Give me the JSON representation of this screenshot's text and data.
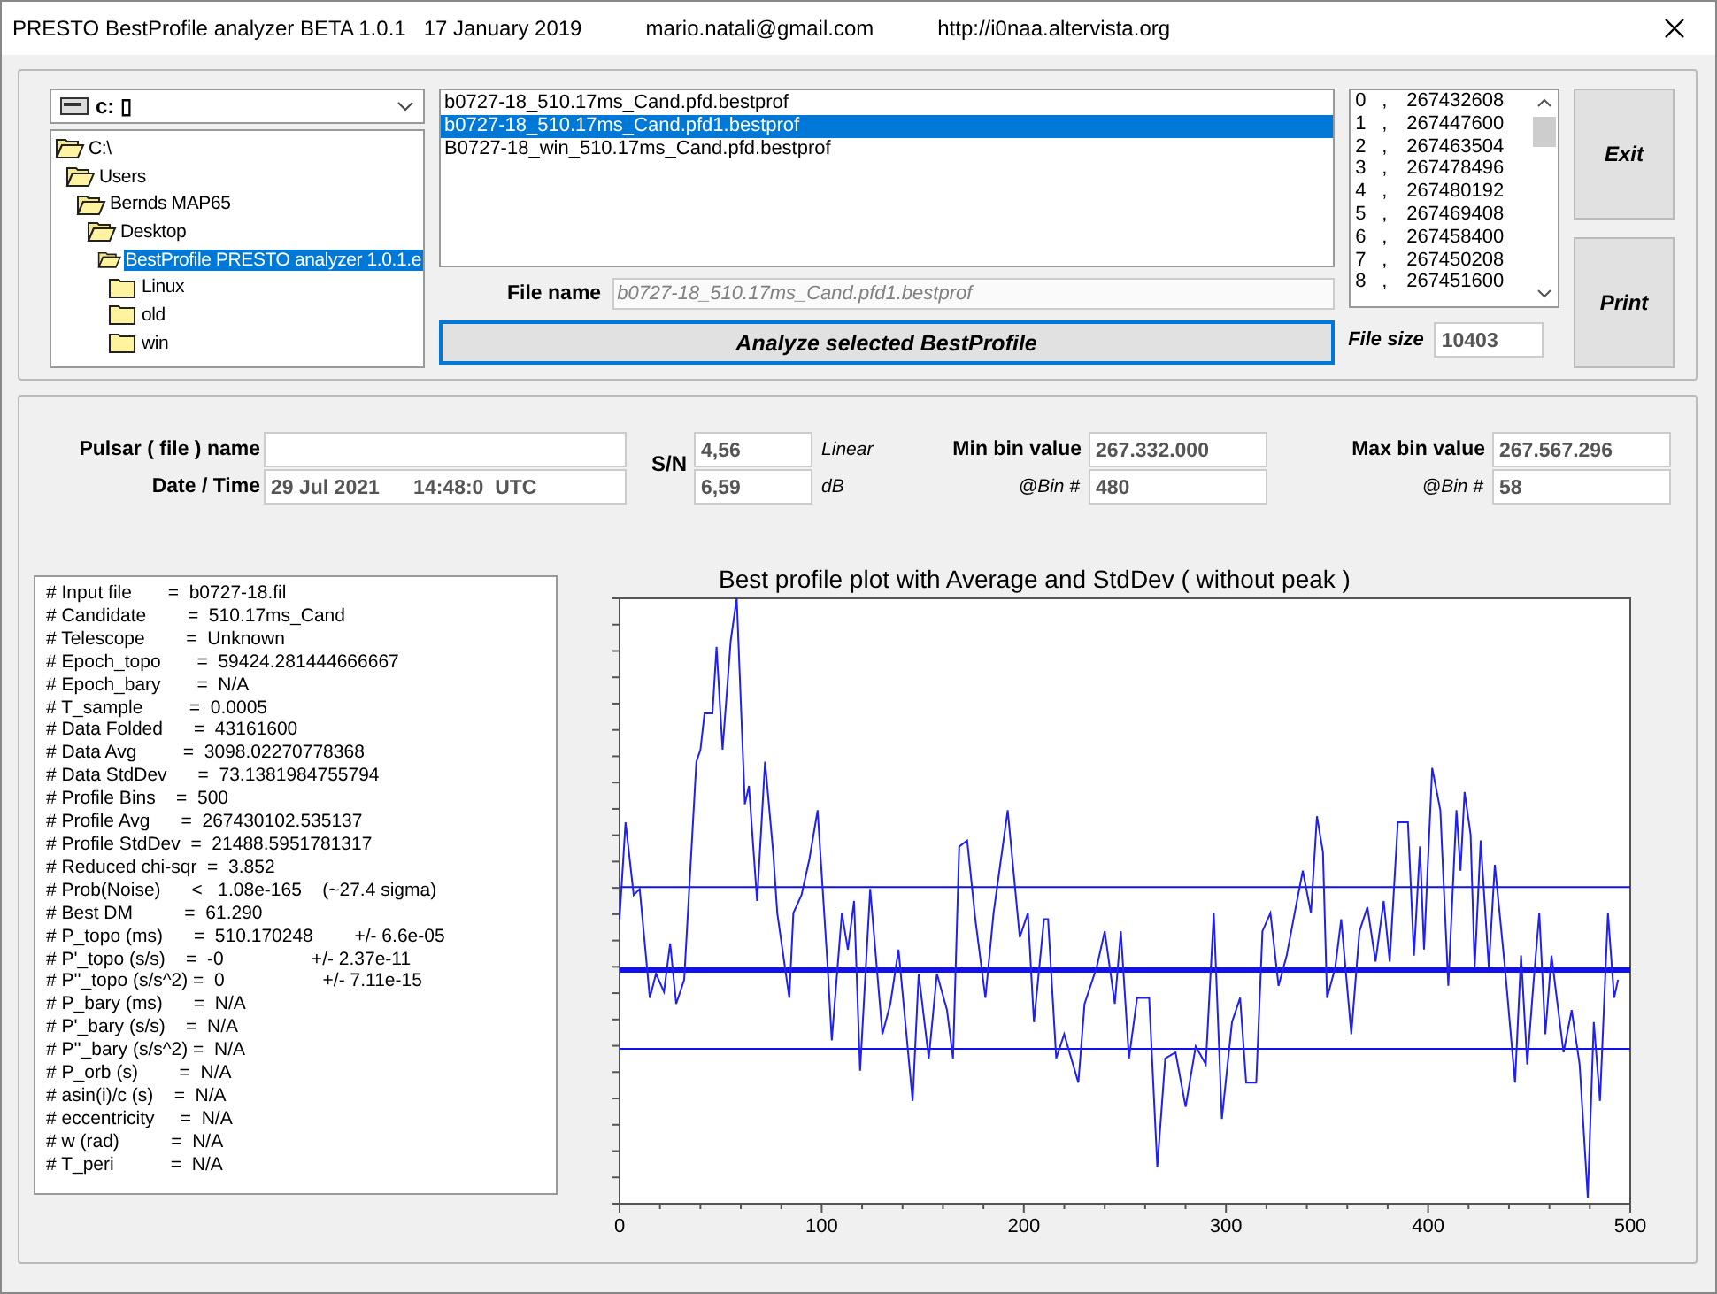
{
  "window": {
    "title": "PRESTO BestProfile analyzer BETA 1.0.1   17 January 2019",
    "email": "mario.natali@gmail.com",
    "url": "http://i0naa.altervista.org"
  },
  "drive": {
    "value": "c: ▯"
  },
  "tree": [
    {
      "label": "C:\\",
      "expanded": true,
      "selected": false,
      "children": [
        {
          "label": "Users",
          "expanded": true,
          "selected": false,
          "children": [
            {
              "label": "Bernds MAP65",
              "expanded": true,
              "selected": false,
              "children": [
                {
                  "label": "Desktop",
                  "expanded": true,
                  "selected": false,
                  "children": [
                    {
                      "label": "BestProfile PRESTO analyzer 1.0.1.e",
                      "expanded": true,
                      "selected": true,
                      "children": [
                        {
                          "label": "Linux",
                          "expanded": false,
                          "selected": false
                        },
                        {
                          "label": "old",
                          "expanded": false,
                          "selected": false
                        },
                        {
                          "label": "win",
                          "expanded": false,
                          "selected": false
                        }
                      ]
                    }
                  ]
                }
              ]
            }
          ]
        }
      ]
    }
  ],
  "files": [
    {
      "name": "b0727-18_510.17ms_Cand.pfd.bestprof",
      "selected": false
    },
    {
      "name": "b0727-18_510.17ms_Cand.pfd1.bestprof",
      "selected": true
    },
    {
      "name": "B0727-18_win_510.17ms_Cand.pfd.bestprof",
      "selected": false
    }
  ],
  "file_name": {
    "label": "File name",
    "value": "b0727-18_510.17ms_Cand.pfd1.bestprof",
    "disabled": true
  },
  "analyze_button": "Analyze selected BestProfile",
  "bins": [
    {
      "index": "0",
      "value": "267432608"
    },
    {
      "index": "1",
      "value": "267447600"
    },
    {
      "index": "2",
      "value": "267463504"
    },
    {
      "index": "3",
      "value": "267478496"
    },
    {
      "index": "4",
      "value": "267480192"
    },
    {
      "index": "5",
      "value": "267469408"
    },
    {
      "index": "6",
      "value": "267458400"
    },
    {
      "index": "7",
      "value": "267450208"
    },
    {
      "index": "8",
      "value": "267451600"
    }
  ],
  "bin_separator": ",",
  "file_size": {
    "label": "File size",
    "value": "10403"
  },
  "buttons": [
    "Exit",
    "Print"
  ],
  "pulsar": {
    "label": "Pulsar ( file ) name"
  },
  "date_time": {
    "label": "Date / Time",
    "value": "29 Jul 2021      14:48:0  UTC"
  },
  "sn": {
    "label": "S/N",
    "linear": "4,56",
    "linear_unit": "Linear",
    "db": "6,59",
    "db_unit": "dB"
  },
  "min_bin": {
    "label": "Min bin value",
    "value": "267.332.000",
    "bin_label": "@Bin #",
    "bin": "480"
  },
  "max_bin": {
    "label": "Max bin value",
    "value": "267.567.296",
    "bin_label": "@Bin #",
    "bin": "58"
  },
  "info_lines": [
    "# Input file       =  b0727-18.fil",
    "# Candidate        =  510.17ms_Cand",
    "# Telescope        =  Unknown",
    "# Epoch_topo       =  59424.281444666667",
    "# Epoch_bary       =  N/A",
    "# T_sample         =  0.0005",
    "# Data Folded      =  43161600",
    "# Data Avg         =  3098.02270778368",
    "# Data StdDev      =  73.1381984755794",
    "# Profile Bins    =  500",
    "# Profile Avg      =  267430102.535137",
    "# Profile StdDev  =  21488.5951781317",
    "# Reduced chi-sqr  =  3.852",
    "# Prob(Noise)      <   1.08e-165    (~27.4 sigma)",
    "# Best DM          =  61.290",
    "# P_topo (ms)      =  510.170248        +/- 6.6e-05",
    "# P'_topo (s/s)    =  -0                 +/- 2.37e-11",
    "# P''_topo (s/s^2) =  0                   +/- 7.11e-15",
    "# P_bary (ms)      =  N/A",
    "# P'_bary (s/s)    =  N/A",
    "# P''_bary (s/s^2) =  N/A",
    "# P_orb (s)        =  N/A",
    "# asin(i)/c (s)    =  N/A",
    "# eccentricity     =  N/A",
    "# w (rad)          =  N/A",
    "# T_peri           =  N/A"
  ],
  "plot": {
    "title": "Best profile plot with  Average and StdDev ( without peak )",
    "x_tick_labels": [
      "0",
      "100",
      "200",
      "300",
      "400",
      "500"
    ]
  }
}
